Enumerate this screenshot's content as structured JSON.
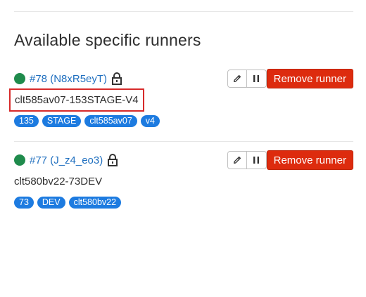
{
  "section": {
    "title": "Available specific runners"
  },
  "runners": [
    {
      "link": "#78 (N8xR5eyT)",
      "name": "clt585av07-153STAGE-V4",
      "tags": [
        "135",
        "STAGE",
        "clt585av07",
        "v4"
      ],
      "highlighted": true
    },
    {
      "link": "#77 (J_z4_eo3)",
      "name": "clt580bv22-73DEV",
      "tags": [
        "73",
        "DEV",
        "clt580bv22"
      ],
      "highlighted": false
    }
  ],
  "actions": {
    "remove_label": "Remove runner"
  },
  "icons": {
    "status": "status-online-icon",
    "lock": "lock-icon",
    "edit": "pencil-icon",
    "pause": "pause-icon"
  },
  "colors": {
    "status_online": "#1f8b4c",
    "link": "#1f6fbf",
    "tag_bg": "#1d7be0",
    "remove_bg": "#dd2b0e",
    "highlight_border": "#d72a2a"
  }
}
